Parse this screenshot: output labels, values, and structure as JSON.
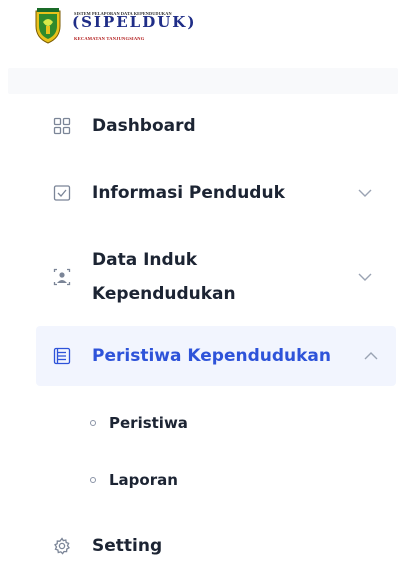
{
  "logo": {
    "line1": "SISTEM PELAPORAN DATA KEPENDUDUKAN",
    "brand": "(SIPELDUK)",
    "line3": "KECAMATAN TANJUNGSIANG"
  },
  "menu": [
    {
      "label": "Dashboard",
      "icon": "grid-icon",
      "expandable": false
    },
    {
      "label": "Informasi Penduduk",
      "icon": "checkbox-icon",
      "expandable": true
    },
    {
      "label_line1": "Data Induk",
      "label_line2": "Kependudukan",
      "icon": "id-card-icon",
      "expandable": true
    },
    {
      "label": "Peristiwa Kependudukan",
      "icon": "list-icon",
      "expandable": true,
      "expanded": true,
      "children": [
        {
          "label": "Peristiwa"
        },
        {
          "label": "Laporan"
        }
      ]
    },
    {
      "label": "Setting",
      "icon": "gear-icon",
      "expandable": false
    }
  ],
  "colors": {
    "active_text": "#2e53d9",
    "active_bg": "#f2f5fe",
    "text": "#1c2433",
    "icon": "#7b8597"
  }
}
